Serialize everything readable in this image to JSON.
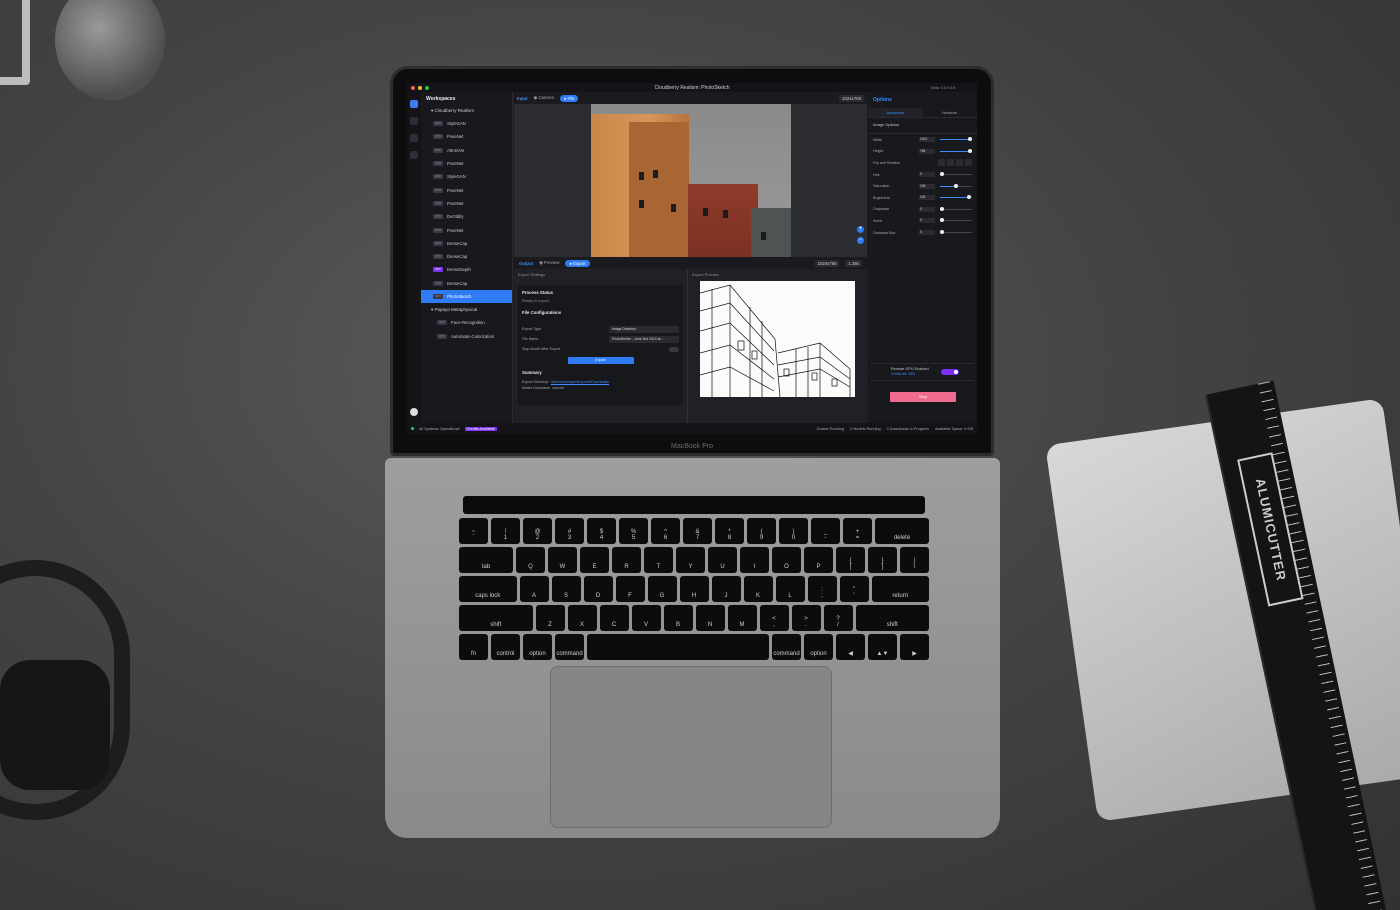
{
  "window": {
    "title": "Cloudberry Realism: PhotoSketch",
    "version": "Beta V.0.9.15"
  },
  "laptop": {
    "brand": "MacBook Pro"
  },
  "ruler_brand": "ALUMICUTTER",
  "sidebar": {
    "title": "Workspaces",
    "group1": "Cloudberry Realism",
    "items": [
      {
        "tag": "GPU",
        "label": "StyleGAN",
        "purple": false
      },
      {
        "tag": "CPU",
        "label": "PoseNet",
        "purple": false
      },
      {
        "tag": "GPU",
        "label": "AttnGAN",
        "purple": false
      },
      {
        "tag": "CPU",
        "label": "PoseNet",
        "purple": false
      },
      {
        "tag": "GPU",
        "label": "StyleGAN",
        "purple": false
      },
      {
        "tag": "CPU",
        "label": "PoseNet",
        "purple": false
      },
      {
        "tag": "CPU",
        "label": "PoseNet",
        "purple": false
      },
      {
        "tag": "CPU",
        "label": "DeOldify",
        "purple": false
      },
      {
        "tag": "CPU",
        "label": "PoseNet",
        "purple": false
      },
      {
        "tag": "GPU",
        "label": "DenseCap",
        "purple": false
      },
      {
        "tag": "CPU",
        "label": "DenseCap",
        "purple": false
      },
      {
        "tag": "GPU",
        "label": "DenseDepth",
        "purple": true
      },
      {
        "tag": "CPU",
        "label": "DenseCap",
        "purple": false
      },
      {
        "tag": "GPU",
        "label": "PhotoSketch",
        "purple": false,
        "active": true
      }
    ],
    "group2": "Papaya Metaphysical",
    "items2": [
      {
        "tag": "CPU",
        "label": "Face-Recognition"
      },
      {
        "tag": "CPU",
        "label": "Automatic-Colorization"
      }
    ]
  },
  "input": {
    "label": "Input",
    "camera": "Camera",
    "file": "File",
    "dims": "1024x768"
  },
  "output": {
    "label": "Output",
    "preview": "Preview",
    "export": "Export",
    "dims": "1024x768",
    "time": "1.38s"
  },
  "export_settings": {
    "heading": "Export Settings",
    "process_status": "Process Status",
    "status_text": "Ready to export.",
    "file_config": "File Configurations",
    "export_type_label": "Export Type",
    "export_type_value": "Image Directory",
    "file_name_label": "File Name",
    "file_name_value": "PhotoSketch - June 3nd 2019 at...",
    "stop_label": "Stop Model After Export",
    "export_button": "Export",
    "summary": "Summary",
    "export_dir_label": "Export Directory:",
    "export_dir_value": "/Users/runwayml/exports/Downloads",
    "model_cmd_label": "Model Command:",
    "model_cmd_value": "convert"
  },
  "export_preview": {
    "heading": "Export Preview"
  },
  "options": {
    "title": "Options",
    "tabs": [
      "Advanced",
      "Network"
    ],
    "section": "Image Options",
    "width_label": "Width",
    "width_value": "1024",
    "width_level": 0.95,
    "height_label": "Height",
    "height_value": "768",
    "height_level": 0.95,
    "flip_label": "Flip and Rotation",
    "hue_label": "Hue",
    "hue_value": "0",
    "hue_level": 0.05,
    "saturation_label": "Saturation",
    "saturation_value": "100",
    "saturation_level": 0.5,
    "brightness_label": "Brightness",
    "brightness_value": "100",
    "brightness_level": 0.92,
    "grayscale_label": "Grayscale",
    "grayscale_value": "0",
    "grayscale_level": 0.05,
    "invert_label": "Invert",
    "invert_value": "0",
    "invert_level": 0.05,
    "blur_label": "Gaussian Blur",
    "blur_value": "0",
    "blur_level": 0.05,
    "gpu_title": "Remote GPU Enabled",
    "gpu_sub": "Credits left: 3000",
    "stop_button": "Stop"
  },
  "statusbar": {
    "systems": "All Systems Operational",
    "credits": "Credits Available",
    "docker": "Docker Running",
    "models": "2 Models Running",
    "downloads": "0 Downloads In Progress",
    "space": "Available Space: 6 GB"
  },
  "keyboard": {
    "row1": [
      "~\n`",
      "!\n1",
      "@\n2",
      "#\n3",
      "$\n4",
      "%\n5",
      "^\n6",
      "&\n7",
      "*\n8",
      "(\n9",
      ")\n0",
      "_\n-",
      "+\n=",
      "delete"
    ],
    "row2": [
      "tab",
      "Q",
      "W",
      "E",
      "R",
      "T",
      "Y",
      "U",
      "I",
      "O",
      "P",
      "{\n[",
      "}\n]",
      "|\n\\"
    ],
    "row3": [
      "caps lock",
      "A",
      "S",
      "D",
      "F",
      "G",
      "H",
      "J",
      "K",
      "L",
      ":\n;",
      "\"\n'",
      "return"
    ],
    "row4": [
      "shift",
      "Z",
      "X",
      "C",
      "V",
      "B",
      "N",
      "M",
      "<\n,",
      ">\n.",
      "?\n/",
      "shift"
    ],
    "row5": [
      "fn",
      "control",
      "option",
      "command",
      "",
      "command",
      "option",
      "◀",
      "▲▼",
      "▶"
    ]
  },
  "colors": {
    "accent": "#2f7bf5",
    "purple": "#7b2ff2",
    "stop": "#ef6b8f",
    "status_ok": "#25d17c"
  }
}
